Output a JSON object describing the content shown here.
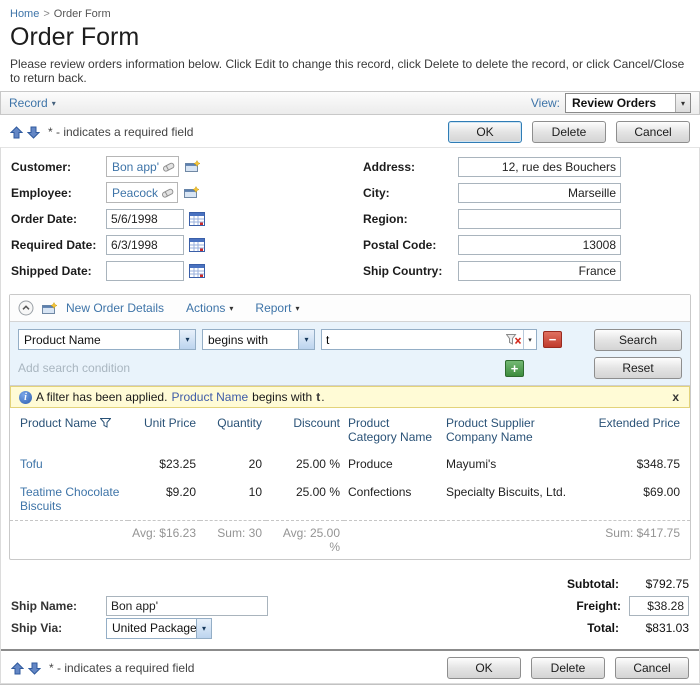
{
  "breadcrumb": {
    "home": "Home",
    "separator": ">",
    "current": "Order Form"
  },
  "header": {
    "title": "Order Form",
    "instructions": "Please review orders information below. Click Edit to change this record, click Delete to delete the record, or click Cancel/Close to return back."
  },
  "toolbar": {
    "record": "Record",
    "view_label": "View:",
    "view_value": "Review Orders"
  },
  "action_bar": {
    "required_note": "* - indicates a required field",
    "ok": "OK",
    "delete": "Delete",
    "cancel": "Cancel"
  },
  "form": {
    "customer": {
      "label": "Customer:",
      "value": "Bon app'"
    },
    "employee": {
      "label": "Employee:",
      "value": "Peacock"
    },
    "order_date": {
      "label": "Order Date:",
      "value": "5/6/1998"
    },
    "required_date": {
      "label": "Required Date:",
      "value": "6/3/1998"
    },
    "shipped_date": {
      "label": "Shipped Date:",
      "value": ""
    },
    "address": {
      "label": "Address:",
      "value": "12, rue des Bouchers"
    },
    "city": {
      "label": "City:",
      "value": "Marseille"
    },
    "region": {
      "label": "Region:",
      "value": ""
    },
    "postal_code": {
      "label": "Postal Code:",
      "value": "13008"
    },
    "ship_country": {
      "label": "Ship Country:",
      "value": "France"
    }
  },
  "details": {
    "new_link": "New Order Details",
    "actions": "Actions",
    "report": "Report",
    "search": {
      "field": "Product Name",
      "operator": "begins with",
      "value": "t",
      "placeholder": "Add search condition",
      "search_button": "Search",
      "reset_button": "Reset"
    },
    "filter_notice": {
      "prefix": "A filter has been applied.",
      "field": "Product Name",
      "operator": "begins with",
      "value": "t",
      "period": ".",
      "close": "x"
    },
    "table": {
      "columns": [
        "Product Name",
        "Unit Price",
        "Quantity",
        "Discount",
        "Product Category Name",
        "Product Supplier Company Name",
        "Extended Price"
      ],
      "rows": [
        {
          "product": "Tofu",
          "unit_price": "$23.25",
          "quantity": "20",
          "discount": "25.00 %",
          "category": "Produce",
          "supplier": "Mayumi's",
          "extended": "$348.75"
        },
        {
          "product": "Teatime Chocolate Biscuits",
          "unit_price": "$9.20",
          "quantity": "10",
          "discount": "25.00 %",
          "category": "Confections",
          "supplier": "Specialty Biscuits, Ltd.",
          "extended": "$69.00"
        }
      ],
      "aggregates": {
        "unit_price": "Avg: $16.23",
        "quantity": "Sum: 30",
        "discount": "Avg: 25.00 %",
        "extended": "Sum: $417.75"
      }
    }
  },
  "totals": {
    "subtotal_label": "Subtotal:",
    "subtotal_value": "$792.75",
    "freight_label": "Freight:",
    "freight_value": "$38.28",
    "total_label": "Total:",
    "total_value": "$831.03"
  },
  "ship": {
    "name_label": "Ship Name:",
    "name_value": "Bon app'",
    "via_label": "Ship Via:",
    "via_value": "United Package"
  },
  "colors": {
    "link": "#3e74a8",
    "table_header": "#2a5277",
    "filter_bar_bg": "#fffbd6",
    "search_area_bg": "#e9f3fb",
    "primary_button_border": "#2f7cb5"
  }
}
